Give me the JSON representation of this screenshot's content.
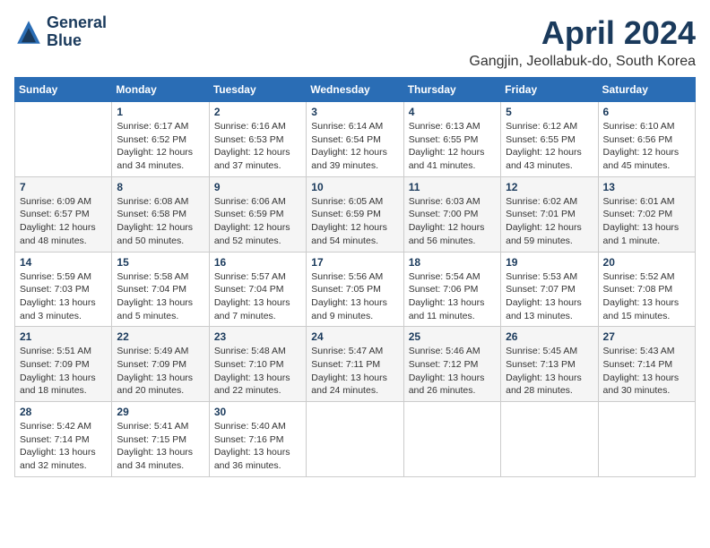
{
  "header": {
    "logo_line1": "General",
    "logo_line2": "Blue",
    "title": "April 2024",
    "location": "Gangjin, Jeollabuk-do, South Korea"
  },
  "days_of_week": [
    "Sunday",
    "Monday",
    "Tuesday",
    "Wednesday",
    "Thursday",
    "Friday",
    "Saturday"
  ],
  "weeks": [
    [
      {
        "day": "",
        "info": ""
      },
      {
        "day": "1",
        "info": "Sunrise: 6:17 AM\nSunset: 6:52 PM\nDaylight: 12 hours\nand 34 minutes."
      },
      {
        "day": "2",
        "info": "Sunrise: 6:16 AM\nSunset: 6:53 PM\nDaylight: 12 hours\nand 37 minutes."
      },
      {
        "day": "3",
        "info": "Sunrise: 6:14 AM\nSunset: 6:54 PM\nDaylight: 12 hours\nand 39 minutes."
      },
      {
        "day": "4",
        "info": "Sunrise: 6:13 AM\nSunset: 6:55 PM\nDaylight: 12 hours\nand 41 minutes."
      },
      {
        "day": "5",
        "info": "Sunrise: 6:12 AM\nSunset: 6:55 PM\nDaylight: 12 hours\nand 43 minutes."
      },
      {
        "day": "6",
        "info": "Sunrise: 6:10 AM\nSunset: 6:56 PM\nDaylight: 12 hours\nand 45 minutes."
      }
    ],
    [
      {
        "day": "7",
        "info": "Sunrise: 6:09 AM\nSunset: 6:57 PM\nDaylight: 12 hours\nand 48 minutes."
      },
      {
        "day": "8",
        "info": "Sunrise: 6:08 AM\nSunset: 6:58 PM\nDaylight: 12 hours\nand 50 minutes."
      },
      {
        "day": "9",
        "info": "Sunrise: 6:06 AM\nSunset: 6:59 PM\nDaylight: 12 hours\nand 52 minutes."
      },
      {
        "day": "10",
        "info": "Sunrise: 6:05 AM\nSunset: 6:59 PM\nDaylight: 12 hours\nand 54 minutes."
      },
      {
        "day": "11",
        "info": "Sunrise: 6:03 AM\nSunset: 7:00 PM\nDaylight: 12 hours\nand 56 minutes."
      },
      {
        "day": "12",
        "info": "Sunrise: 6:02 AM\nSunset: 7:01 PM\nDaylight: 12 hours\nand 59 minutes."
      },
      {
        "day": "13",
        "info": "Sunrise: 6:01 AM\nSunset: 7:02 PM\nDaylight: 13 hours\nand 1 minute."
      }
    ],
    [
      {
        "day": "14",
        "info": "Sunrise: 5:59 AM\nSunset: 7:03 PM\nDaylight: 13 hours\nand 3 minutes."
      },
      {
        "day": "15",
        "info": "Sunrise: 5:58 AM\nSunset: 7:04 PM\nDaylight: 13 hours\nand 5 minutes."
      },
      {
        "day": "16",
        "info": "Sunrise: 5:57 AM\nSunset: 7:04 PM\nDaylight: 13 hours\nand 7 minutes."
      },
      {
        "day": "17",
        "info": "Sunrise: 5:56 AM\nSunset: 7:05 PM\nDaylight: 13 hours\nand 9 minutes."
      },
      {
        "day": "18",
        "info": "Sunrise: 5:54 AM\nSunset: 7:06 PM\nDaylight: 13 hours\nand 11 minutes."
      },
      {
        "day": "19",
        "info": "Sunrise: 5:53 AM\nSunset: 7:07 PM\nDaylight: 13 hours\nand 13 minutes."
      },
      {
        "day": "20",
        "info": "Sunrise: 5:52 AM\nSunset: 7:08 PM\nDaylight: 13 hours\nand 15 minutes."
      }
    ],
    [
      {
        "day": "21",
        "info": "Sunrise: 5:51 AM\nSunset: 7:09 PM\nDaylight: 13 hours\nand 18 minutes."
      },
      {
        "day": "22",
        "info": "Sunrise: 5:49 AM\nSunset: 7:09 PM\nDaylight: 13 hours\nand 20 minutes."
      },
      {
        "day": "23",
        "info": "Sunrise: 5:48 AM\nSunset: 7:10 PM\nDaylight: 13 hours\nand 22 minutes."
      },
      {
        "day": "24",
        "info": "Sunrise: 5:47 AM\nSunset: 7:11 PM\nDaylight: 13 hours\nand 24 minutes."
      },
      {
        "day": "25",
        "info": "Sunrise: 5:46 AM\nSunset: 7:12 PM\nDaylight: 13 hours\nand 26 minutes."
      },
      {
        "day": "26",
        "info": "Sunrise: 5:45 AM\nSunset: 7:13 PM\nDaylight: 13 hours\nand 28 minutes."
      },
      {
        "day": "27",
        "info": "Sunrise: 5:43 AM\nSunset: 7:14 PM\nDaylight: 13 hours\nand 30 minutes."
      }
    ],
    [
      {
        "day": "28",
        "info": "Sunrise: 5:42 AM\nSunset: 7:14 PM\nDaylight: 13 hours\nand 32 minutes."
      },
      {
        "day": "29",
        "info": "Sunrise: 5:41 AM\nSunset: 7:15 PM\nDaylight: 13 hours\nand 34 minutes."
      },
      {
        "day": "30",
        "info": "Sunrise: 5:40 AM\nSunset: 7:16 PM\nDaylight: 13 hours\nand 36 minutes."
      },
      {
        "day": "",
        "info": ""
      },
      {
        "day": "",
        "info": ""
      },
      {
        "day": "",
        "info": ""
      },
      {
        "day": "",
        "info": ""
      }
    ]
  ]
}
